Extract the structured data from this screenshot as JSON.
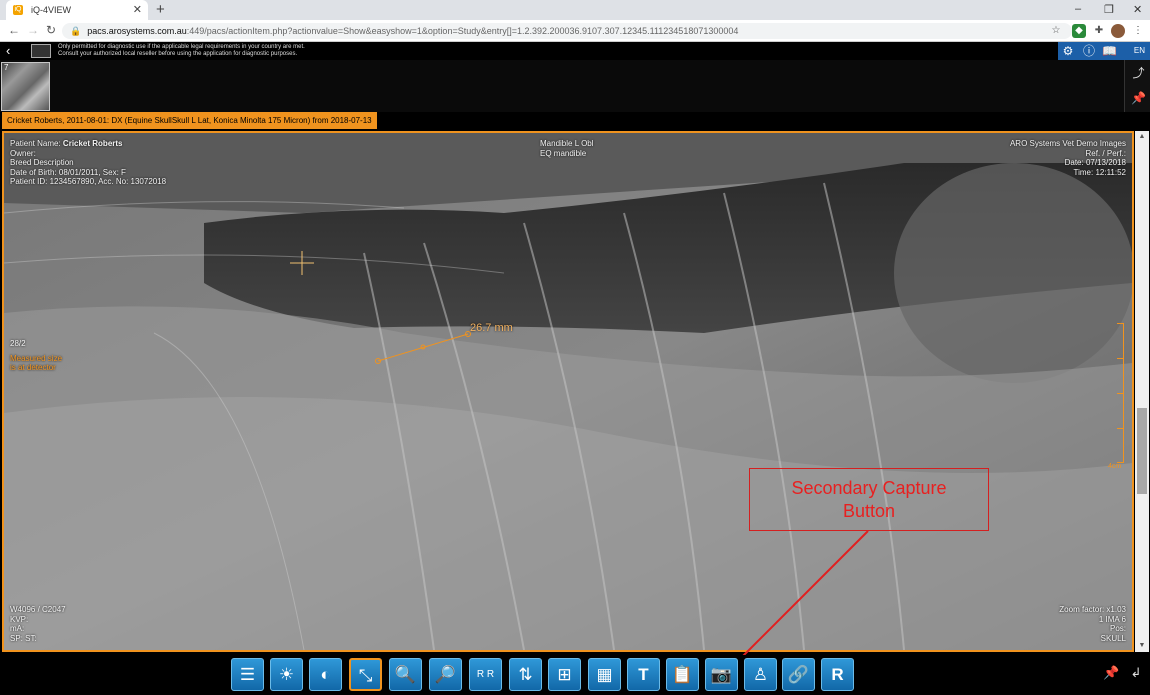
{
  "browser": {
    "tab_title": "iQ-4VIEW",
    "favicon_text": "iQ",
    "url_host": "pacs.arosystems.com.au",
    "url_rest": ":449/pacs/actionItem.php?actionvalue=Show&easyshow=1&option=Study&entry[]=1.2.392.200036.9107.307.12345.111234518071300004"
  },
  "app": {
    "notice_line1": "Only permitted for diagnostic use if the applicable legal requirements in your country are met.",
    "notice_line2": "Consult your authorized local reseller before using the application for diagnostic purposes.",
    "language": "EN",
    "thumbnail_number": "7",
    "series_label": "Cricket Roberts, 2011-08-01: DX (Equine SkullSkull L Lat, Konica Minolta 175 Micron) from 2018-07-13"
  },
  "overlay": {
    "top_left": {
      "patient_name_label": "Patient Name: ",
      "patient_name": "Cricket Roberts",
      "owner": "Owner:",
      "breed": "Breed Description",
      "dob": "Date of Birth: 08/01/2011, Sex: F",
      "ids": "Patient ID: 1234567890, Acc. No: 13072018"
    },
    "top_center": {
      "line1": "Mandible L Obl",
      "line2": "EQ mandible"
    },
    "top_right": {
      "line1": "ARO Systems Vet Demo Images",
      "line2": "Ref. / Perf.:",
      "line3": "Date: 07/13/2018",
      "line4": "Time: 12:11:52"
    },
    "mid_left": {
      "line1": "28/2",
      "line2": "Measured size",
      "line3": "is at detector"
    },
    "bottom_left": {
      "line1": "W4096 / C2047",
      "line2": "KVP:",
      "line3": "mA:",
      "line4": "SP: ST:"
    },
    "bottom_right": {
      "line1": "Zoom factor: x1.03",
      "line2": "1 IMA 6",
      "line3": "Pos:",
      "line4": "SKULL"
    },
    "measurement": "26.7 mm",
    "scale_label": "4cm"
  },
  "annotation": {
    "callout_line1": "Secondary Capture",
    "callout_line2": "Button"
  },
  "toolbar": {
    "tools": [
      {
        "name": "study-list-tool",
        "icon": "study-list-icon"
      },
      {
        "name": "brightness-tool",
        "icon": "brightness-icon"
      },
      {
        "name": "contrast-tool",
        "icon": "contrast-icon"
      },
      {
        "name": "measure-tool",
        "icon": "measure-icon",
        "active": true
      },
      {
        "name": "zoom-tool",
        "icon": "magnifier-icon"
      },
      {
        "name": "zoom-pan-tool",
        "icon": "magnifier-pan-icon"
      },
      {
        "name": "rotate-tool",
        "icon": "rotate-icon",
        "label": "R R"
      },
      {
        "name": "flip-tool",
        "icon": "flip-icon"
      },
      {
        "name": "layout-2x2-tool",
        "icon": "grid-2x2-icon"
      },
      {
        "name": "layout-grid-tool",
        "icon": "grid-icon"
      },
      {
        "name": "text-tool",
        "icon": "text-icon",
        "label": "T"
      },
      {
        "name": "report-tool",
        "icon": "clipboard-icon"
      },
      {
        "name": "secondary-capture-tool",
        "icon": "camera-icon"
      },
      {
        "name": "skeleton-tool",
        "icon": "skeleton-icon"
      },
      {
        "name": "link-tool",
        "icon": "link-icon"
      },
      {
        "name": "reset-tool",
        "icon": "reset-icon",
        "label": "R"
      }
    ]
  },
  "colors": {
    "accent_orange": "#f0931e",
    "tool_blue": "#1f80c4",
    "callout_red": "#d42020",
    "header_blue": "#1c5fa8"
  }
}
